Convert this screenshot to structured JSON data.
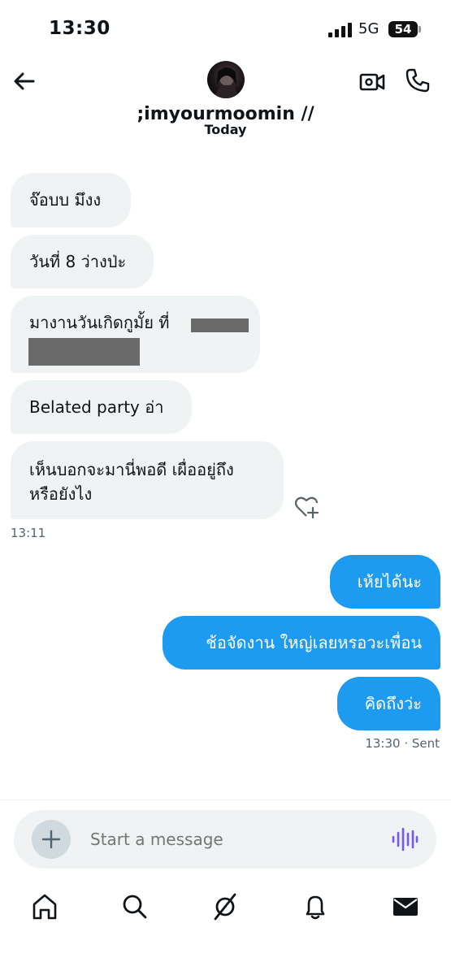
{
  "status_bar": {
    "time": "13:30",
    "network": "5G",
    "battery": "54"
  },
  "header": {
    "contact_name": ";imyourmoomin //",
    "date_separator": "Today"
  },
  "messages": [
    {
      "direction": "in",
      "text": "จ๊อบบ มึงง"
    },
    {
      "direction": "in",
      "text": "วันที่ 8 ว่างป่ะ"
    },
    {
      "direction": "in",
      "text": "มางานวันเกิดกูมั้ย ที่",
      "redacted": true
    },
    {
      "direction": "in",
      "text": "Belated party อ่า"
    },
    {
      "direction": "in",
      "text_line1": "เห็นบอกจะมานี่พอดี เผื่ออยู่ถึง",
      "text_line2": "หรือยังไง"
    },
    {
      "direction": "out",
      "text": "เห้ยได้นะ"
    },
    {
      "direction": "out",
      "text": "ช้อจัดงาน ใหญ่เลยหรอวะเพื่อน"
    },
    {
      "direction": "out",
      "text": "คิดถึงว่ะ"
    }
  ],
  "meta": {
    "incoming_time": "13:11",
    "sent_status": "13:30 · Sent"
  },
  "composer": {
    "placeholder": "Start a message"
  },
  "icons": {
    "back": "back-arrow-icon",
    "video": "video-call-icon",
    "call": "phone-icon",
    "heart": "add-reaction-icon",
    "plus": "plus-icon",
    "voice": "voice-waveform-icon",
    "home": "home-icon",
    "search": "search-icon",
    "grok": "grok-icon",
    "notifications": "bell-icon",
    "messages": "mail-icon"
  },
  "colors": {
    "accent": "#1d9bf0",
    "incoming_bubble": "#eff3f4",
    "voice_icon": "#7856ff"
  }
}
